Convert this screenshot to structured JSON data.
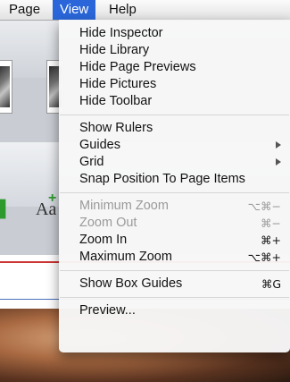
{
  "menubar": {
    "items": [
      {
        "label": "Page",
        "active": false
      },
      {
        "label": "View",
        "active": true
      },
      {
        "label": "Help",
        "active": false
      }
    ]
  },
  "view_menu": {
    "groups": [
      [
        {
          "label": "Hide Inspector",
          "shortcut": "",
          "submenu": false,
          "enabled": true
        },
        {
          "label": "Hide Library",
          "shortcut": "",
          "submenu": false,
          "enabled": true
        },
        {
          "label": "Hide Page Previews",
          "shortcut": "",
          "submenu": false,
          "enabled": true
        },
        {
          "label": "Hide Pictures",
          "shortcut": "",
          "submenu": false,
          "enabled": true
        },
        {
          "label": "Hide Toolbar",
          "shortcut": "",
          "submenu": false,
          "enabled": true
        }
      ],
      [
        {
          "label": "Show Rulers",
          "shortcut": "",
          "submenu": false,
          "enabled": true
        },
        {
          "label": "Guides",
          "shortcut": "",
          "submenu": true,
          "enabled": true
        },
        {
          "label": "Grid",
          "shortcut": "",
          "submenu": true,
          "enabled": true
        },
        {
          "label": "Snap Position To Page Items",
          "shortcut": "",
          "submenu": false,
          "enabled": true
        }
      ],
      [
        {
          "label": "Minimum Zoom",
          "shortcut": "⌥⌘−",
          "submenu": false,
          "enabled": false
        },
        {
          "label": "Zoom Out",
          "shortcut": "⌘−",
          "submenu": false,
          "enabled": false
        },
        {
          "label": "Zoom In",
          "shortcut": "⌘+",
          "submenu": false,
          "enabled": true
        },
        {
          "label": "Maximum Zoom",
          "shortcut": "⌥⌘+",
          "submenu": false,
          "enabled": true
        }
      ],
      [
        {
          "label": "Show Box Guides",
          "shortcut": "⌘G",
          "submenu": false,
          "enabled": true
        }
      ],
      [
        {
          "label": "Preview...",
          "shortcut": "",
          "submenu": false,
          "enabled": true
        }
      ]
    ]
  },
  "background": {
    "text_glyph": "Aa",
    "plus_glyph": "+"
  },
  "colors": {
    "menu_highlight": "#2a66d9",
    "menu_bg": "#f7f7f7",
    "disabled_text": "#9a9a9a"
  }
}
